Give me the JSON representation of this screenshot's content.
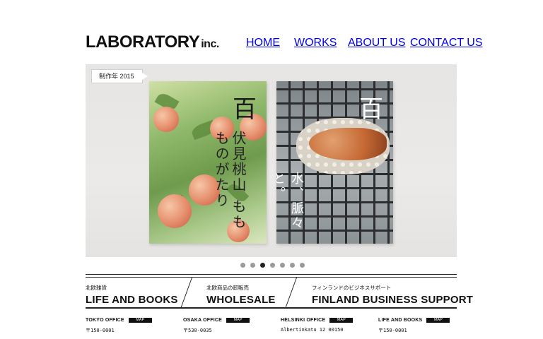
{
  "header": {
    "logo_main": "LABORATORY",
    "logo_suffix": "inc.",
    "nav": [
      {
        "label": "HOME"
      },
      {
        "label": "WORKS"
      },
      {
        "label": "ABOUT US"
      },
      {
        "label": "CONTACT US"
      }
    ]
  },
  "slider": {
    "tag": "制作年 2015",
    "book1": {
      "title_kanji": "百",
      "vertical_text": "伏見桃山 もも ものがたり"
    },
    "book2": {
      "title_kanji": "百",
      "vertical_text": "水、脈々と。"
    },
    "dots": {
      "count": 7,
      "active_index": 2
    }
  },
  "categories": [
    {
      "sub": "北欧雑貨",
      "title": "LIFE AND BOOKS"
    },
    {
      "sub": "北欧商品の卸販売",
      "title": "WHOLESALE"
    },
    {
      "sub": "フィンランドのビジネスサポート",
      "title": "FINLAND BUSINESS SUPPORT"
    }
  ],
  "offices": [
    {
      "name": "TOKYO OFFICE",
      "map": "MAP",
      "address": "〒150-0001"
    },
    {
      "name": "OSAKA OFFICE",
      "map": "MAP",
      "address": "〒530-0035"
    },
    {
      "name": "HELSINKI OFFICE",
      "map": "MAP",
      "address": "Albertinkatu 12 00150"
    },
    {
      "name": "LIFE AND BOOKS",
      "map": "MAP",
      "address": "〒150-0001"
    }
  ]
}
